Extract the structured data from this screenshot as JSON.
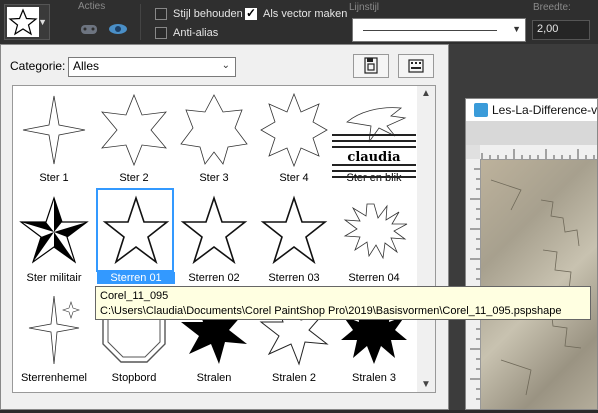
{
  "toolbar": {
    "acties_label": "Acties",
    "stijl_behouden": "Stijl behouden",
    "stijl_behouden_checked": false,
    "als_vector_maken": "Als vector maken",
    "als_vector_maken_checked": true,
    "anti_alias": "Anti-alias",
    "anti_alias_checked": false,
    "lijnstijl_label": "Lijnstijl",
    "breedte_label": "Breedte:",
    "breedte_value": "2,00"
  },
  "dialog": {
    "category_label": "Categorie:",
    "category_value": "Alles",
    "shapes": [
      "Ster 1",
      "Ster 2",
      "Ster 3",
      "Ster 4",
      "Ster en blik",
      "Ster militair",
      "Sterren 01",
      "Sterren 02",
      "Sterren 03",
      "Sterren 04",
      "Sterrenhemel",
      "Stopbord",
      "Stralen",
      "Stralen 2",
      "Stralen 3"
    ],
    "selected_shape": "Sterren 01"
  },
  "tooltip": {
    "name": "Corel_11_095",
    "path": "C:\\Users\\Claudia\\Documents\\Corel PaintShop Pro\\2019\\Basisvormen\\Corel_11_095.pspshape"
  },
  "watermark_text": "claudia",
  "image_window": {
    "title": "Les-La-Difference-v"
  },
  "colors": {
    "accent": "#3399ff",
    "tooltip_bg": "#ffffe1",
    "toolbar_bg": "#2f2f2f"
  }
}
